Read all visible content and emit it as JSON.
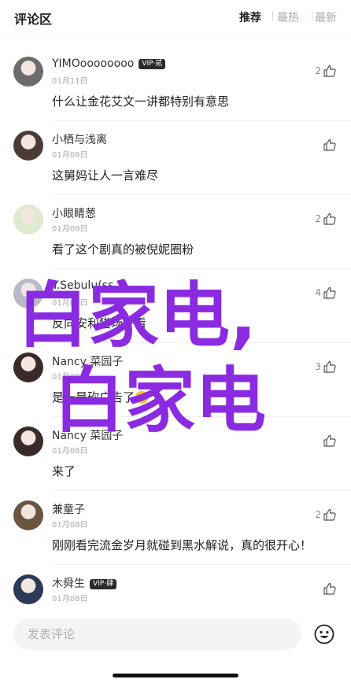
{
  "header": {
    "title": "评论区",
    "tabs": [
      {
        "label": "推荐",
        "active": true
      },
      {
        "label": "最热",
        "active": false
      },
      {
        "label": "最新",
        "active": false
      }
    ]
  },
  "comments": [
    {
      "name": "YIMOoooooooo",
      "badge": "VIP·贰",
      "date": "01月11日",
      "text": "什么让金花艾文一讲都特别有意思",
      "likes": "2",
      "avatar_color": "#6b6b6b"
    },
    {
      "name": "小栖与浅离",
      "badge": "",
      "date": "01月09日",
      "text": "这舅妈让人一言难尽",
      "likes": "",
      "avatar_color": "#4b3a35"
    },
    {
      "name": "小眼睛葱",
      "badge": "",
      "date": "01月09日",
      "text": "看了这个剧真的被倪妮圈粉",
      "likes": "2",
      "avatar_color": "#dfe9cf"
    },
    {
      "name": "Y.Sebulu(ss",
      "badge": "",
      "date": "01月09日",
      "text": "反向安利猎场好看",
      "likes": "4",
      "avatar_color": "#b9b9c8"
    },
    {
      "name": "Nancy 菜园子",
      "badge": "",
      "date": "01月08日",
      "text": "是一是砍广告了🙄",
      "likes": "3",
      "avatar_color": "#3a2a2a"
    },
    {
      "name": "Nancy 菜园子",
      "badge": "",
      "date": "01月08日",
      "text": "来了",
      "likes": "",
      "avatar_color": "#3a2a2a"
    },
    {
      "name": "兼童子",
      "badge": "",
      "date": "01月08日",
      "text": "刚刚看完流金岁月就碰到黑水解说，真的很开心！",
      "likes": "2",
      "avatar_color": "#6a5540"
    },
    {
      "name": "木舜生",
      "badge": "VIP·肆",
      "date": "01月08日",
      "text": "",
      "likes": "",
      "avatar_color": "#2c3a58"
    }
  ],
  "footer": {
    "placeholder": "发表评论"
  },
  "watermark": {
    "line1": "白家电,",
    "line2": "白家电",
    "color": "#8a2be2"
  }
}
